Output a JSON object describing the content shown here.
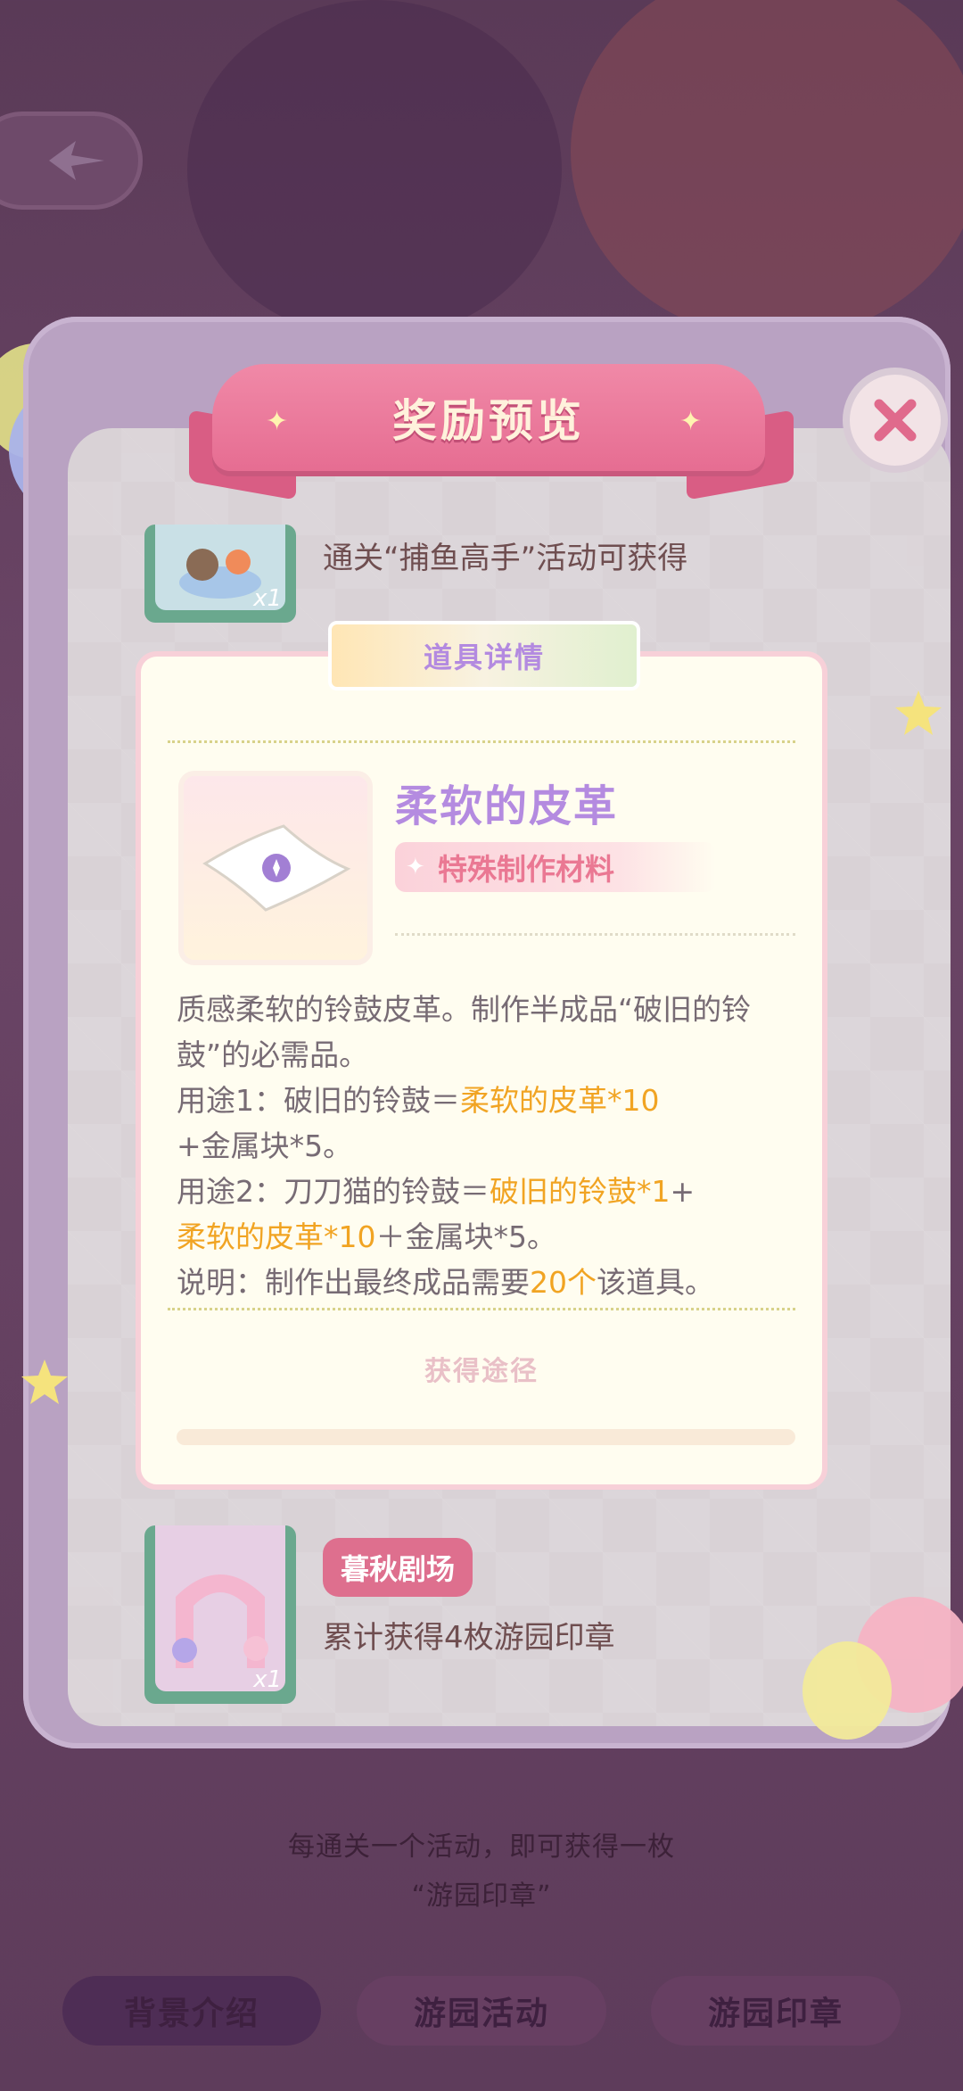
{
  "modal": {
    "title": "奖励预览",
    "close_icon": "close-icon"
  },
  "rewards": [
    {
      "quantity": "x1",
      "description": "通关“捕鱼高手”活动可获得"
    },
    {
      "quantity": "x1",
      "tag": "暮秋剧场",
      "description": "累计获得4枚游园印章"
    }
  ],
  "item_detail": {
    "header": "道具详情",
    "name": "柔软的皮革",
    "type": "特殊制作材料",
    "desc_line1": "质感柔软的铃鼓皮革。制作半成品“破旧的铃",
    "desc_line2": "鼓”的必需品。",
    "use1_prefix": "用途1：破旧的铃鼓＝",
    "use1_hl": "柔软的皮革*10",
    "use1_line2": "+金属块*5。",
    "use2_prefix": "用途2：刀刀猫的铃鼓＝",
    "use2_hl1": "破旧的铃鼓*1",
    "use2_plus": "+",
    "use2_hl2": "柔软的皮革*10",
    "use2_suffix": "＋金属块*5。",
    "note_prefix": "说明：制作出最终成品需要",
    "note_hl": "20个",
    "note_suffix": "该道具。",
    "obtain_title": "获得途径"
  },
  "footer": {
    "hint_line1": "每通关一个活动，即可获得一枚",
    "hint_line2": "“游园印章”",
    "tabs": [
      "背景介绍",
      "游园活动",
      "游园印章"
    ]
  },
  "colors": {
    "accent_pink": "#e66d92",
    "highlight_orange": "#f1a423",
    "title_purple": "#b48be0"
  }
}
